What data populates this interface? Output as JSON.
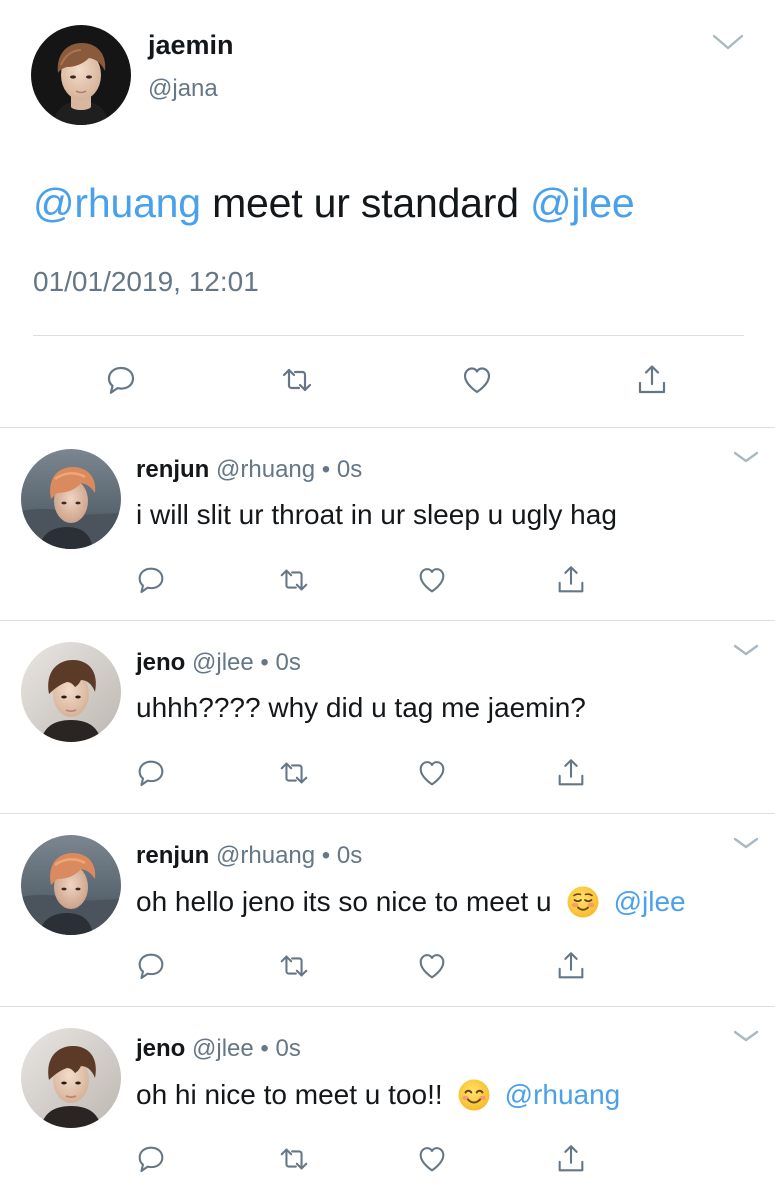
{
  "main_tweet": {
    "name": "jaemin",
    "handle": "@jana",
    "mention_1": "@rhuang",
    "text": " meet ur standard ",
    "mention_2": "@jlee",
    "timestamp": "01/01/2019, 12:01"
  },
  "replies": [
    {
      "name": "renjun",
      "handle": "@rhuang",
      "separator": "•",
      "time": "0s",
      "text": "i will slit ur throat in ur sleep u ugly hag",
      "emoji": "",
      "mention": ""
    },
    {
      "name": "jeno",
      "handle": "@jlee",
      "separator": "•",
      "time": "0s",
      "text": "uhhh???? why did u tag me jaemin?",
      "emoji": "",
      "mention": ""
    },
    {
      "name": "renjun",
      "handle": "@rhuang",
      "separator": "•",
      "time": "0s",
      "text": "oh hello jeno its so nice to meet u",
      "emoji": "relieved-face",
      "mention": "@jlee"
    },
    {
      "name": "jeno",
      "handle": "@jlee",
      "separator": "•",
      "time": "0s",
      "text": "oh hi nice to meet u too!!",
      "emoji": "smiling-face",
      "mention": "@rhuang"
    }
  ],
  "icons": {
    "reply": "reply-icon",
    "retweet": "retweet-icon",
    "like": "heart-icon",
    "share": "share-icon",
    "more": "chevron-down-icon"
  },
  "colors": {
    "mention": "#4aa1eb",
    "secondary_text": "#657786",
    "divider": "#d9dee2"
  }
}
